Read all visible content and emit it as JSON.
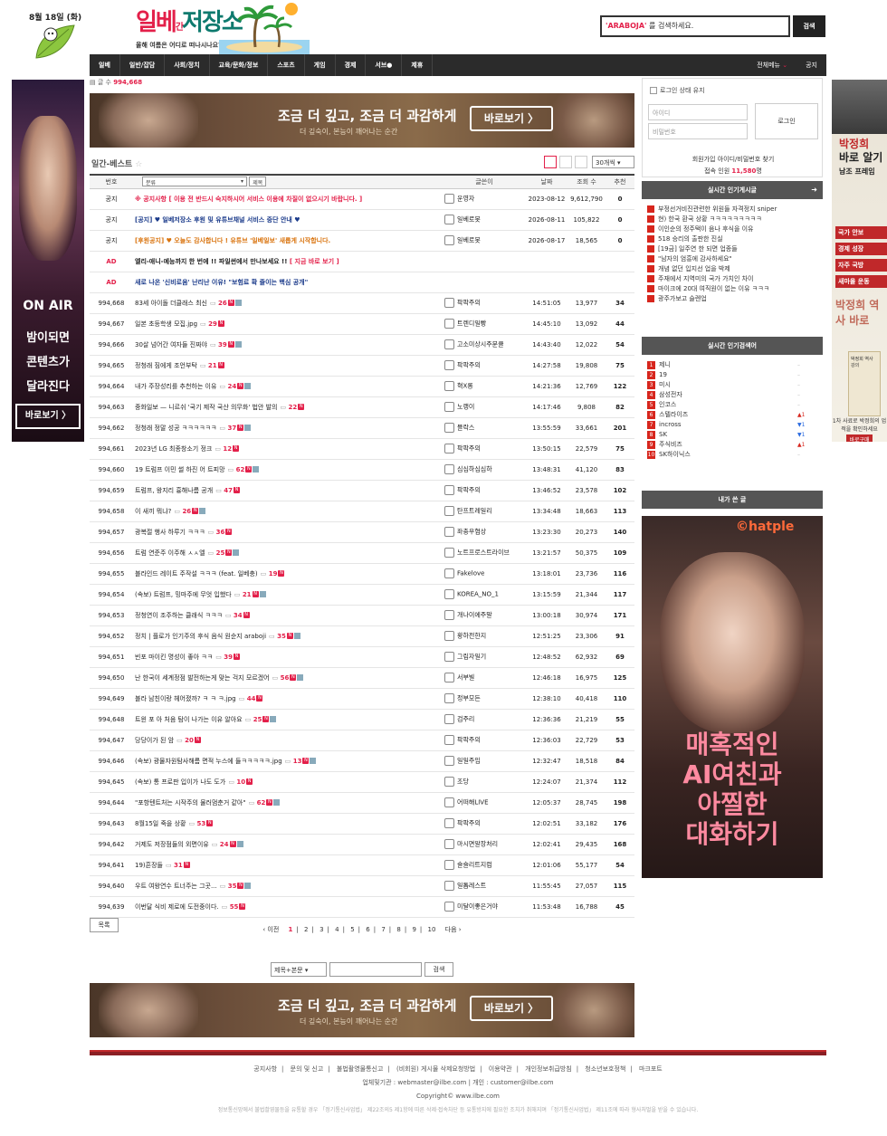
{
  "header": {
    "date": "8월 18일 (화)",
    "logo_red": "일베",
    "logo_small": "간",
    "logo_green": "저장소",
    "tagline": "올해 여름은 어디로 떠나시나요?",
    "search_keyword": "'ARABOJA'",
    "search_suffix": " 를 검색하세요.",
    "search_button": "검색"
  },
  "nav": {
    "items": [
      "일베",
      "일반/잡담",
      "사회/정치",
      "교육/문화/정보",
      "스포츠",
      "게임",
      "경제",
      "서브●",
      "제휴"
    ],
    "all_menu": "전체메뉴",
    "notice": "공지"
  },
  "left_banner": {
    "on_air": "ON AIR",
    "lines": [
      "밤이되면",
      "콘텐츠가",
      "달라진다"
    ],
    "cta": "바로보기 〉"
  },
  "right_banner": {
    "head_lines": [
      "박정희",
      "바로 알기"
    ],
    "head_sub": "남조 프레임",
    "items": [
      "국가 안보",
      "경제 성장",
      "자주 국방",
      "새마을 운동"
    ],
    "big": "박정희 역사 바로",
    "book": "박정희 역사 강의",
    "foot": "1차 사료로 박정희의 업적을 확인하세요",
    "cta": "바로구매"
  },
  "main": {
    "total_label": "글 수",
    "total": "994,668",
    "ad": {
      "title": "조금 더 깊고, 조금 더 과감하게",
      "sub": "더 깊숙이, 본능이 깨어나는 순간",
      "cta": "바로보기 〉"
    },
    "best_title": "일간-베스트",
    "per_page": "30개씩",
    "columns": {
      "no": "번호",
      "category": "분류",
      "title_select": "제목",
      "author": "글쓴이",
      "date": "날짜",
      "views": "조회 수",
      "rec": "추천"
    },
    "notices": [
      {
        "no": "공지",
        "title": "※ 공지사항 [ 이용 전 반드시 숙지하시어 서비스 이용에 차질이 없으시기 바랍니다. ]",
        "author": "운영자",
        "date": "2023-08-12",
        "views": "9,612,790",
        "rec": "0",
        "tone": "r"
      },
      {
        "no": "공지",
        "title": "[공지] ♥ 일베저장소 후원 및 유튜브채널 서비스 중단 안내 ♥",
        "author": "일베로봇",
        "date": "2026-08-11",
        "views": "105,822",
        "rec": "0",
        "tone": "b"
      },
      {
        "no": "공지",
        "title": "[후원공지] ♥ 오늘도 감사합니다 ! 유튜브 '일베일보' 새롭게 시작합니다.",
        "author": "일베로봇",
        "date": "2026-08-17",
        "views": "18,565",
        "rec": "0",
        "tone": "o"
      }
    ],
    "ads": [
      {
        "no": "AD",
        "title_a": "엘리-애니-예능까지 한 번에 !! 파일썬에서 만나보세요 !!",
        "title_b": " [ 지금 바로 보기 ]"
      },
      {
        "no": "AD",
        "title_a": "새로 나온 '신비로움' 난리난 이유! \"보험료 확 줄이는 핵심 공개\"",
        "title_b": ""
      }
    ],
    "rows": [
      {
        "no": "994,668",
        "title": "83세 아이돌 더클래스 최신",
        "c": "26",
        "author": "팍팍주의",
        "date": "14:51:05",
        "views": "13,977",
        "rec": "34"
      },
      {
        "no": "994,667",
        "title": "일본 초등학생 모집.jpg",
        "c": "29",
        "author": "트렌디일빵",
        "date": "14:45:10",
        "views": "13,092",
        "rec": "44"
      },
      {
        "no": "994,666",
        "title": "30살 넘어간 여자들 진짜야",
        "c": "39",
        "author": "고소미상시주문클",
        "date": "14:43:40",
        "views": "12,022",
        "rec": "54"
      },
      {
        "no": "994,665",
        "title": "정청래 짐에게 조언부탁",
        "c": "21",
        "author": "팍팍주의",
        "date": "14:27:58",
        "views": "19,808",
        "rec": "75"
      },
      {
        "no": "994,664",
        "title": "내가 주장성리를 추천하는 이유",
        "c": "24",
        "author": "혁X롱",
        "date": "14:21:36",
        "views": "12,769",
        "rec": "122"
      },
      {
        "no": "994,663",
        "title": "중화일보 — 니르쉬 '국기 제작 국산 의무화' 법안 발의",
        "c": "22",
        "author": "노랭이",
        "date": "14:17:46",
        "views": "9,808",
        "rec": "82"
      },
      {
        "no": "994,662",
        "title": "정청래 정말 성공 ㅋㅋㅋㅋㅋㅋ",
        "c": "37",
        "author": "블락스",
        "date": "13:55:59",
        "views": "33,661",
        "rec": "201"
      },
      {
        "no": "994,661",
        "title": "2023년 LG 최종창소기 정크",
        "c": "12",
        "author": "팍팍주의",
        "date": "13:50:15",
        "views": "22,579",
        "rec": "75"
      },
      {
        "no": "994,660",
        "title": "19 트럼프 이민 썰 하진 어 트피망",
        "c": "62",
        "author": "심심하심심하",
        "date": "13:48:31",
        "views": "41,120",
        "rec": "83"
      },
      {
        "no": "994,659",
        "title": "트럼프, 왕지리 흉해나름 공개",
        "c": "47",
        "author": "팍팍주의",
        "date": "13:46:52",
        "views": "23,578",
        "rec": "102"
      },
      {
        "no": "994,658",
        "title": "이 새끼 뭐냐?",
        "c": "26",
        "author": "탄프트레일리",
        "date": "13:34:48",
        "views": "18,663",
        "rec": "113"
      },
      {
        "no": "994,657",
        "title": "광복절 행사 하루기 ㅋㅋㅋ",
        "c": "36",
        "author": "좌충우협상",
        "date": "13:23:30",
        "views": "20,273",
        "rec": "140"
      },
      {
        "no": "994,656",
        "title": "트럼 연준주 이주해 ㅅㅅ엘",
        "c": "25",
        "author": "노트프로스트라이브",
        "date": "13:21:57",
        "views": "50,375",
        "rec": "109"
      },
      {
        "no": "994,655",
        "title": "블라인드 레이트 주작설 ㅋㅋㅋ (feat. 일베충)",
        "c": "19",
        "author": "Fakelove",
        "date": "13:18:01",
        "views": "23,736",
        "rec": "116"
      },
      {
        "no": "994,654",
        "title": "(속보) 트럼프, 밍마주에 무엇 입했다",
        "c": "21",
        "author": "KOREA_NO_1",
        "date": "13:15:59",
        "views": "21,344",
        "rec": "117"
      },
      {
        "no": "994,653",
        "title": "정청연이 조주하는 클래식 ㅋㅋㅋ",
        "c": "34",
        "author": "개나이에주말",
        "date": "13:00:18",
        "views": "30,974",
        "rec": "171"
      },
      {
        "no": "994,652",
        "title": "정치 | 플로가 인기주의 후식 음식 원순지 araboji",
        "c": "35",
        "author": "황하전한지",
        "date": "12:51:25",
        "views": "23,306",
        "rec": "91"
      },
      {
        "no": "994,651",
        "title": "빈포 마이킨 명성이 좋아 ㅋㅋ",
        "c": "39",
        "author": "그림자일기",
        "date": "12:48:52",
        "views": "62,932",
        "rec": "69"
      },
      {
        "no": "994,650",
        "title": "난 한국이 세계정점 발전하는게 맞는 걱지 모르겠어",
        "c": "56",
        "author": "서부빌",
        "date": "12:46:18",
        "views": "16,975",
        "rec": "125"
      },
      {
        "no": "994,649",
        "title": "블라 남친이랑 헤어졌까? ㅋ ㅋ ㅋ.jpg",
        "c": "44",
        "author": "정부모든",
        "date": "12:38:10",
        "views": "40,418",
        "rec": "110"
      },
      {
        "no": "994,648",
        "title": "트윈 포 아 처음 탐이 나가는 이유 알아요",
        "c": "25",
        "author": "검주리",
        "date": "12:36:36",
        "views": "21,219",
        "rec": "55"
      },
      {
        "no": "994,647",
        "title": "당당이가 된 암",
        "c": "20",
        "author": "팍팍주의",
        "date": "12:36:03",
        "views": "22,729",
        "rec": "53"
      },
      {
        "no": "994,646",
        "title": "(속보) 광물자원탐사해름 면적 누스에 들ㅋㅋㅋㅋㅋ.jpg",
        "c": "13",
        "author": "일일주임",
        "date": "12:32:47",
        "views": "18,518",
        "rec": "84"
      },
      {
        "no": "994,645",
        "title": "(속보) 통 프로판 입이가 나도 도가",
        "c": "10",
        "author": "조당",
        "date": "12:24:07",
        "views": "21,374",
        "rec": "112"
      },
      {
        "no": "994,644",
        "title": "\"포항텐트처는 시작주의 물러멈춘거 같아\"",
        "c": "62",
        "author": "어떠해LIVE",
        "date": "12:05:37",
        "views": "28,745",
        "rec": "198"
      },
      {
        "no": "994,643",
        "title": "8월15일 죽을 상황",
        "c": "53",
        "author": "팍팍주의",
        "date": "12:02:51",
        "views": "33,182",
        "rec": "176"
      },
      {
        "no": "994,642",
        "title": "거제도 저장점들의 외면이유",
        "c": "24",
        "author": "마시면알장처리",
        "date": "12:02:41",
        "views": "29,435",
        "rec": "168"
      },
      {
        "no": "994,641",
        "title": "19)흔장들",
        "c": "31",
        "author": "슬슬리트지럼",
        "date": "12:01:06",
        "views": "55,177",
        "rec": "54"
      },
      {
        "no": "994,640",
        "title": "우트 여왕연수 트너주는 그곳...",
        "c": "35",
        "author": "일톱레스트",
        "date": "11:55:45",
        "views": "27,057",
        "rec": "115"
      },
      {
        "no": "994,639",
        "title": "이번달 식비 제로에 도전중이다.",
        "c": "55",
        "author": "미달이좋은거야",
        "date": "11:53:48",
        "views": "16,788",
        "rec": "45"
      }
    ],
    "list_button": "목록",
    "paging": {
      "prev": "‹ 이전",
      "pages": [
        "1",
        "2",
        "3",
        "4",
        "5",
        "6",
        "7",
        "8",
        "9",
        "10"
      ],
      "next": "다음 ›"
    },
    "search_scope": "제목+본문",
    "search_button": "검색"
  },
  "aside": {
    "keep_login": "로그인 상태 유지",
    "id_placeholder": "아이디",
    "pw_placeholder": "비밀번호",
    "login_button": "로그인",
    "links": "회원가입   아이디/비밀번호 찾기",
    "online_label": "접속 인원 ",
    "online_count": "11,580",
    "online_suffix": "명",
    "hot_title": "실시간 인기게시글",
    "hot_items": [
      "부정선거비진관련한 위원들 자격정지 sniper",
      "현) 한국 환국 상황 ㅋㅋㅋㅋㅋㅋㅋㅋㅋ",
      "이인순의 정주택이 음나 후식을 이유",
      "518 승리의 출판한 진실",
      "[19금] 일주연 한 되면 업종들",
      "\"남자의 엄흥에 감사하세요\"",
      "개념 없던 입지선 업을 박제",
      "주재에서 지역미의 국가 가치인 차이",
      "마이크에 20대 여직원이 없는 이유 ㅋㅋㅋ",
      "광주가보고 슬렌업"
    ],
    "kw_title": "실시간 인기검색어",
    "keywords": [
      {
        "rank": "1",
        "word": "제니",
        "change": "–",
        "dir": "nc"
      },
      {
        "rank": "2",
        "word": "19",
        "change": "–",
        "dir": "nc"
      },
      {
        "rank": "3",
        "word": "미시",
        "change": "–",
        "dir": "nc"
      },
      {
        "rank": "4",
        "word": "삼성전자",
        "change": "–",
        "dir": "nc"
      },
      {
        "rank": "5",
        "word": "인코스",
        "change": "–",
        "dir": "nc"
      },
      {
        "rank": "6",
        "word": "스텔라이즈",
        "change": "▲1",
        "dir": "up"
      },
      {
        "rank": "7",
        "word": "incross",
        "change": "▼1",
        "dir": "dn"
      },
      {
        "rank": "8",
        "word": "SK",
        "change": "▼1",
        "dir": "dn"
      },
      {
        "rank": "9",
        "word": "주식비즈",
        "change": "▲1",
        "dir": "up"
      },
      {
        "rank": "10",
        "word": "SK하이닉스",
        "change": "–",
        "dir": "nc"
      }
    ],
    "mine_title": "내가 쓴 글",
    "chat_brand": "©hatple",
    "chat_lines": [
      "매혹적인",
      "AI여친과",
      "아찔한",
      "대화하기"
    ]
  },
  "footer": {
    "links": [
      "공지사항",
      "문의 및 신고",
      "불법촬영물통신고",
      "(비회원) 게시물 삭제요청방법",
      "이용약관",
      "개인정보취급방침",
      "청소년보호정책",
      "마크포트"
    ],
    "contact": "업체및기관 : webmaster@ilbe.com  |  개인 : customer@ilbe.com",
    "copyright": "Copyright© www.ilbe.com",
    "notice": "정보통신망에서 불법촬영물등을 유통할 경우 「정기통신사업법」 제22조의5 제1항에 따른 삭제·접속차단 등 유통방지에 필요한 조치가 취해지며 「정기통신사업법」 제11조에 따라 형사처벌을 받을 수 있습니다."
  }
}
